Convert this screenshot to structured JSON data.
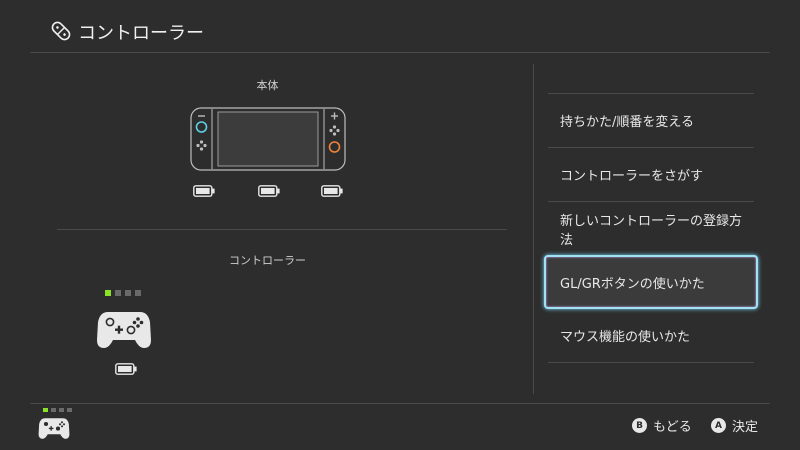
{
  "header": {
    "title": "コントローラー",
    "icon": "joycon-icon"
  },
  "main": {
    "console_label": "本体",
    "controller_label": "コントローラー",
    "player_leds": [
      true,
      false,
      false,
      false
    ],
    "batteries": [
      "battery-icon",
      "battery-icon",
      "battery-icon",
      "battery-icon"
    ]
  },
  "menu": {
    "items": [
      {
        "label": "持ちかた/順番を変える"
      },
      {
        "label": "コントローラーをさがす"
      },
      {
        "label": "新しいコントローラーの登録方法"
      },
      {
        "label": "GL/GRボタンの使いかた",
        "selected": true
      },
      {
        "label": "マウス機能の使いかた"
      }
    ]
  },
  "footer": {
    "back_button": "B",
    "back_label": "もどる",
    "ok_button": "A",
    "ok_label": "決定"
  },
  "colors": {
    "background": "#2d2d2d",
    "led_on": "#8be328",
    "joycon_left_accent": "#5fd0e6",
    "joycon_right_accent": "#f0833a",
    "selection_glow": "#9fe3f2"
  }
}
